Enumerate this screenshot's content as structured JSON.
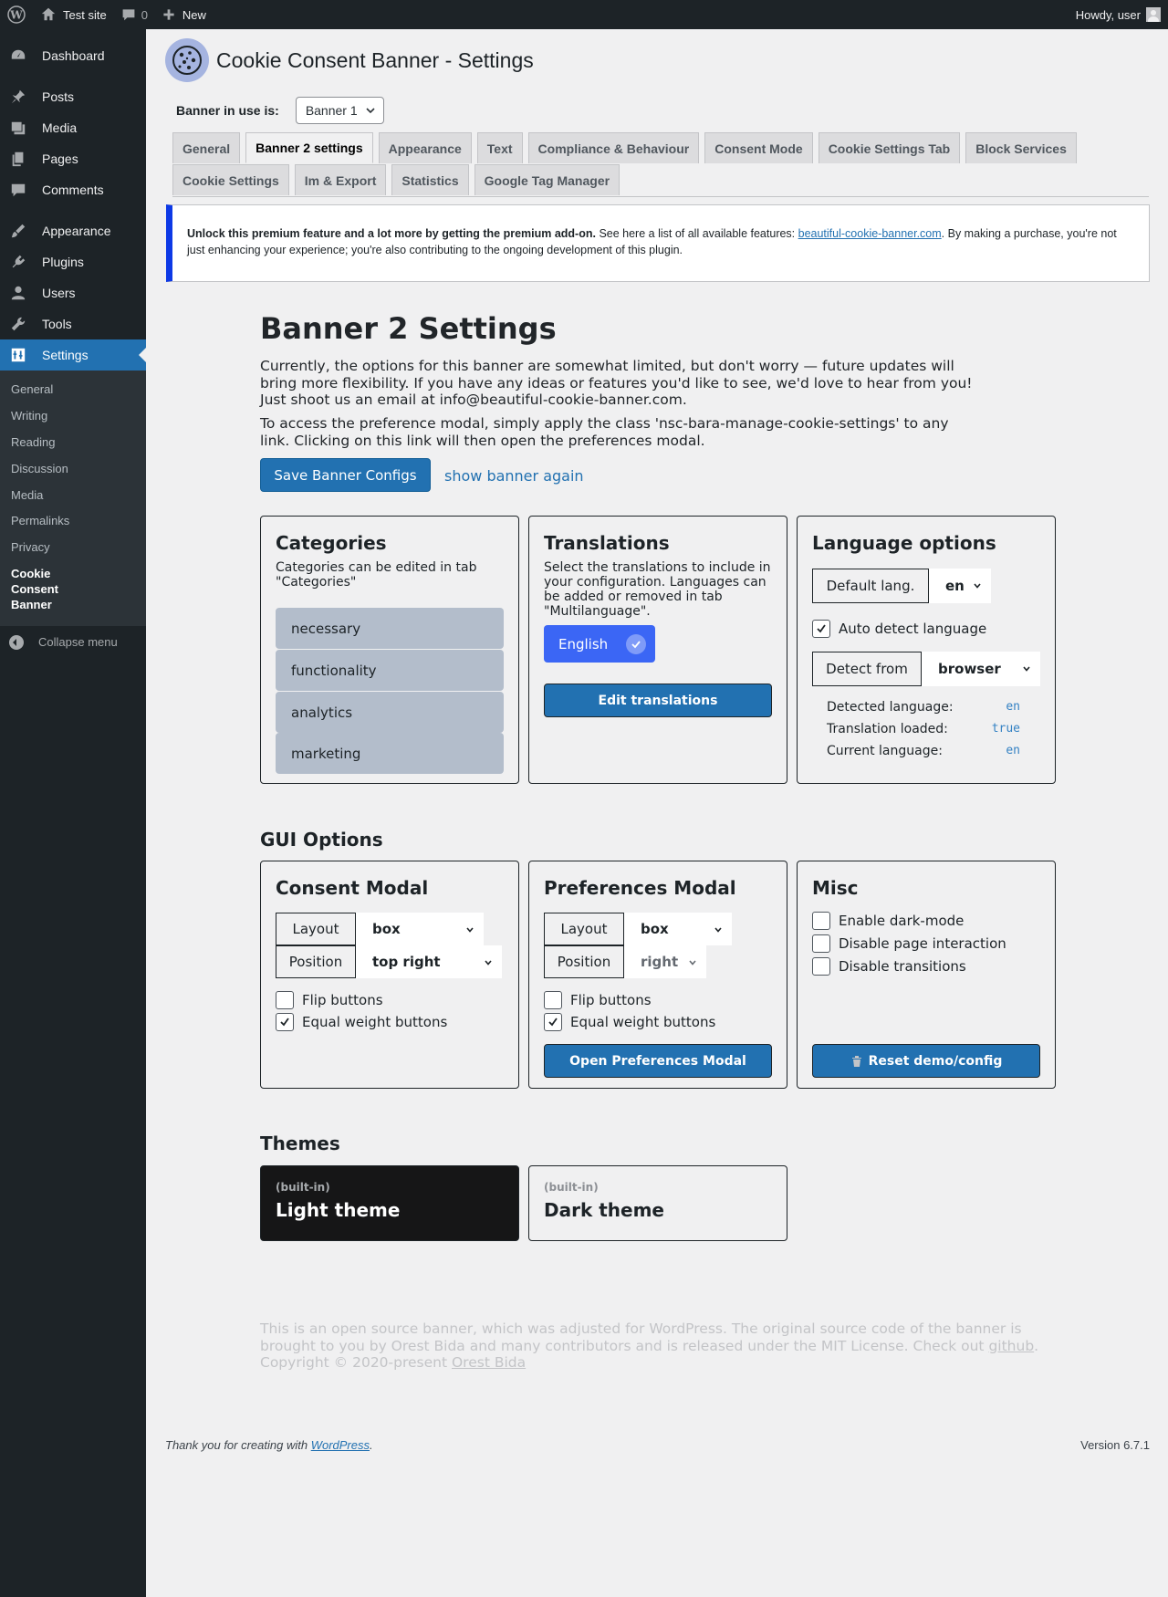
{
  "adminbar": {
    "site_name": "Test site",
    "comments_count": "0",
    "new_label": "New",
    "howdy": "Howdy, user"
  },
  "sidebar": {
    "items": [
      {
        "label": "Dashboard",
        "icon": "dashboard-icon"
      },
      {
        "label": "Posts",
        "icon": "pin-icon"
      },
      {
        "label": "Media",
        "icon": "media-icon"
      },
      {
        "label": "Pages",
        "icon": "page-icon"
      },
      {
        "label": "Comments",
        "icon": "comment-icon"
      },
      {
        "label": "Appearance",
        "icon": "brush-icon"
      },
      {
        "label": "Plugins",
        "icon": "plug-icon"
      },
      {
        "label": "Users",
        "icon": "user-icon"
      },
      {
        "label": "Tools",
        "icon": "wrench-icon"
      },
      {
        "label": "Settings",
        "icon": "settings-icon"
      }
    ],
    "submenu": [
      "General",
      "Writing",
      "Reading",
      "Discussion",
      "Media",
      "Permalinks",
      "Privacy"
    ],
    "submenu_current": "Cookie Consent Banner",
    "collapse": "Collapse menu"
  },
  "header": {
    "title": "Cookie Consent Banner - Settings",
    "banner_label": "Banner in use is:",
    "banner_value": "Banner 1"
  },
  "tabs": {
    "row1": [
      "General",
      "Banner 2 settings",
      "Appearance",
      "Text",
      "Compliance & Behaviour",
      "Consent Mode",
      "Cookie Settings Tab",
      "Block Services"
    ],
    "row2": [
      "Cookie Settings",
      "Im & Export",
      "Statistics",
      "Google Tag Manager"
    ],
    "active": "Banner 2 settings"
  },
  "notice": {
    "strong": "Unlock this premium feature and a lot more by getting the premium add-on.",
    "text1": " See here a list of all available features: ",
    "link": "beautiful-cookie-banner.com",
    "text2": ". By making a purchase, you're not just enhancing your experience; you're also contributing to the ongoing development of this plugin."
  },
  "content": {
    "title": "Banner 2 Settings",
    "para1": "Currently, the options for this banner are somewhat limited, but don't worry — future updates will bring more flexibility. If you have any ideas or features you'd like to see, we'd love to hear from you! Just shoot us an email at info@beautiful-cookie-banner.com.",
    "para2": "To access the preference modal, simply apply the class 'nsc-bara-manage-cookie-settings' to any link. Clicking on this link will then open the preferences modal.",
    "save_button": "Save Banner Configs",
    "show_again": "show banner again"
  },
  "categories": {
    "title": "Categories",
    "desc": "Categories can be edited in tab \"Categories\"",
    "items": [
      "necessary",
      "functionality",
      "analytics",
      "marketing"
    ]
  },
  "translations": {
    "title": "Translations",
    "desc": "Select the translations to include in your configuration. Languages can be added or removed in tab \"Multilanguage\".",
    "pill": "English",
    "edit_button": "Edit translations"
  },
  "language": {
    "title": "Language options",
    "default_label": "Default lang.",
    "default_value": "en",
    "auto_detect": "Auto detect language",
    "auto_detect_checked": true,
    "detect_from_label": "Detect from",
    "detect_from_value": "browser",
    "detected_label": "Detected language:",
    "detected_value": "en",
    "loaded_label": "Translation loaded:",
    "loaded_value": "true",
    "current_label": "Current language:",
    "current_value": "en"
  },
  "gui": {
    "title": "GUI Options",
    "consent": {
      "title": "Consent Modal",
      "layout_label": "Layout",
      "layout_value": "box",
      "position_label": "Position",
      "position_value": "top right",
      "flip": "Flip buttons",
      "flip_checked": false,
      "equal": "Equal weight buttons",
      "equal_checked": true
    },
    "preferences": {
      "title": "Preferences Modal",
      "layout_label": "Layout",
      "layout_value": "box",
      "position_label": "Position",
      "position_value": "right",
      "flip": "Flip buttons",
      "flip_checked": false,
      "equal": "Equal weight buttons",
      "equal_checked": true,
      "open_button": "Open Preferences Modal"
    },
    "misc": {
      "title": "Misc",
      "dark": "Enable dark-mode",
      "disable_interaction": "Disable page interaction",
      "disable_transitions": "Disable transitions",
      "reset_button": "Reset demo/config"
    }
  },
  "themes": {
    "title": "Themes",
    "items": [
      {
        "tag": "(built-in)",
        "name": "Light theme"
      },
      {
        "tag": "(built-in)",
        "name": "Dark theme"
      }
    ]
  },
  "footer_note": {
    "text1": "This is an open source banner, which was adjusted for WordPress. The original source code of the banner is brought to you by Orest Bida and many contributors and is released under the MIT License. Check out ",
    "github": "github",
    "text2": ". Copyright © 2020-present ",
    "author": "Orest Bida"
  },
  "wpfooter": {
    "thanks": "Thank you for creating with ",
    "link": "WordPress",
    "dot": ".",
    "version": "Version 6.7.1"
  },
  "colors": {
    "accent": "#2271b1",
    "adminbar": "#1d2327",
    "pill": "#3b66f5",
    "category": "#b3bdcb"
  }
}
